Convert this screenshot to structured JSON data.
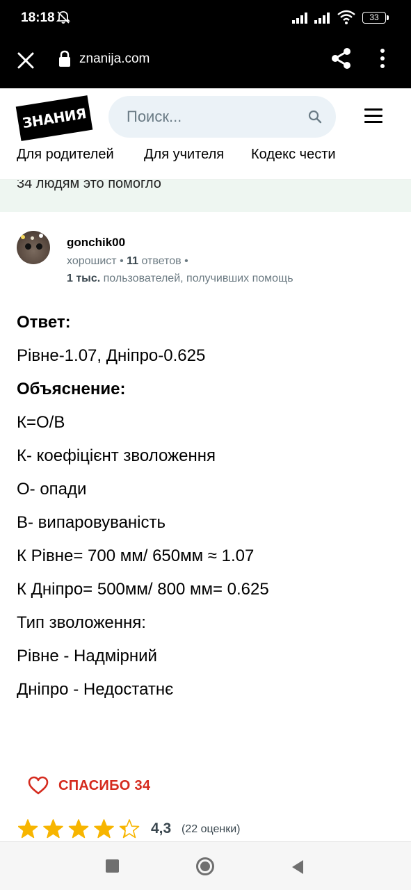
{
  "status_bar": {
    "time": "18:18",
    "battery": "33",
    "icons": [
      "bell-off-icon",
      "signal-icon",
      "signal-icon",
      "wifi-icon",
      "battery-icon"
    ]
  },
  "browser": {
    "url": "znanija.com",
    "icons": [
      "close-icon",
      "lock-icon",
      "share-icon",
      "more-vert-icon"
    ]
  },
  "header": {
    "logo_text": "ЗНАНИЯ",
    "search_placeholder": "Поиск...",
    "nav": [
      "Для родителей",
      "Для учителя",
      "Кодекс чести"
    ]
  },
  "helped_banner": "34 людям это помогло",
  "author": {
    "name": "gonchik00",
    "rank": "хорошист",
    "answers_count": "11",
    "answers_label": "ответов",
    "helped_count": "1 тыс.",
    "helped_label": "пользователей, получивших помощь"
  },
  "answer": {
    "lines": [
      {
        "text": "Ответ:",
        "heading": true
      },
      {
        "text": "Рівне-1.07, Дніпро-0.625",
        "heading": false
      },
      {
        "text": "Объяснение:",
        "heading": true
      },
      {
        "text": "К=О/В",
        "heading": false
      },
      {
        "text": "К- коефіцієнт зволоження",
        "heading": false
      },
      {
        "text": "О- опади",
        "heading": false
      },
      {
        "text": "В- випаровуваність",
        "heading": false
      },
      {
        "text": "К Рівне= 700 мм/ 650мм ≈ 1.07",
        "heading": false
      },
      {
        "text": "К Дніпро= 500мм/ 800 мм= 0.625",
        "heading": false
      },
      {
        "text": "Тип зволоження:",
        "heading": false
      },
      {
        "text": "Рівне - Надмірний",
        "heading": false
      },
      {
        "text": "Дніпро - Недостатнє",
        "heading": false
      }
    ]
  },
  "thanks": {
    "label": "СПАСИБО 34"
  },
  "rating": {
    "average": "4,3",
    "value": 4.3,
    "max": 5,
    "count_label": "(22 оценки)",
    "star_color": "#f7b500"
  },
  "colors": {
    "thanks_red": "#d52b1e",
    "banner_bg": "#eef6f1",
    "search_bg": "#ebf2f7"
  }
}
